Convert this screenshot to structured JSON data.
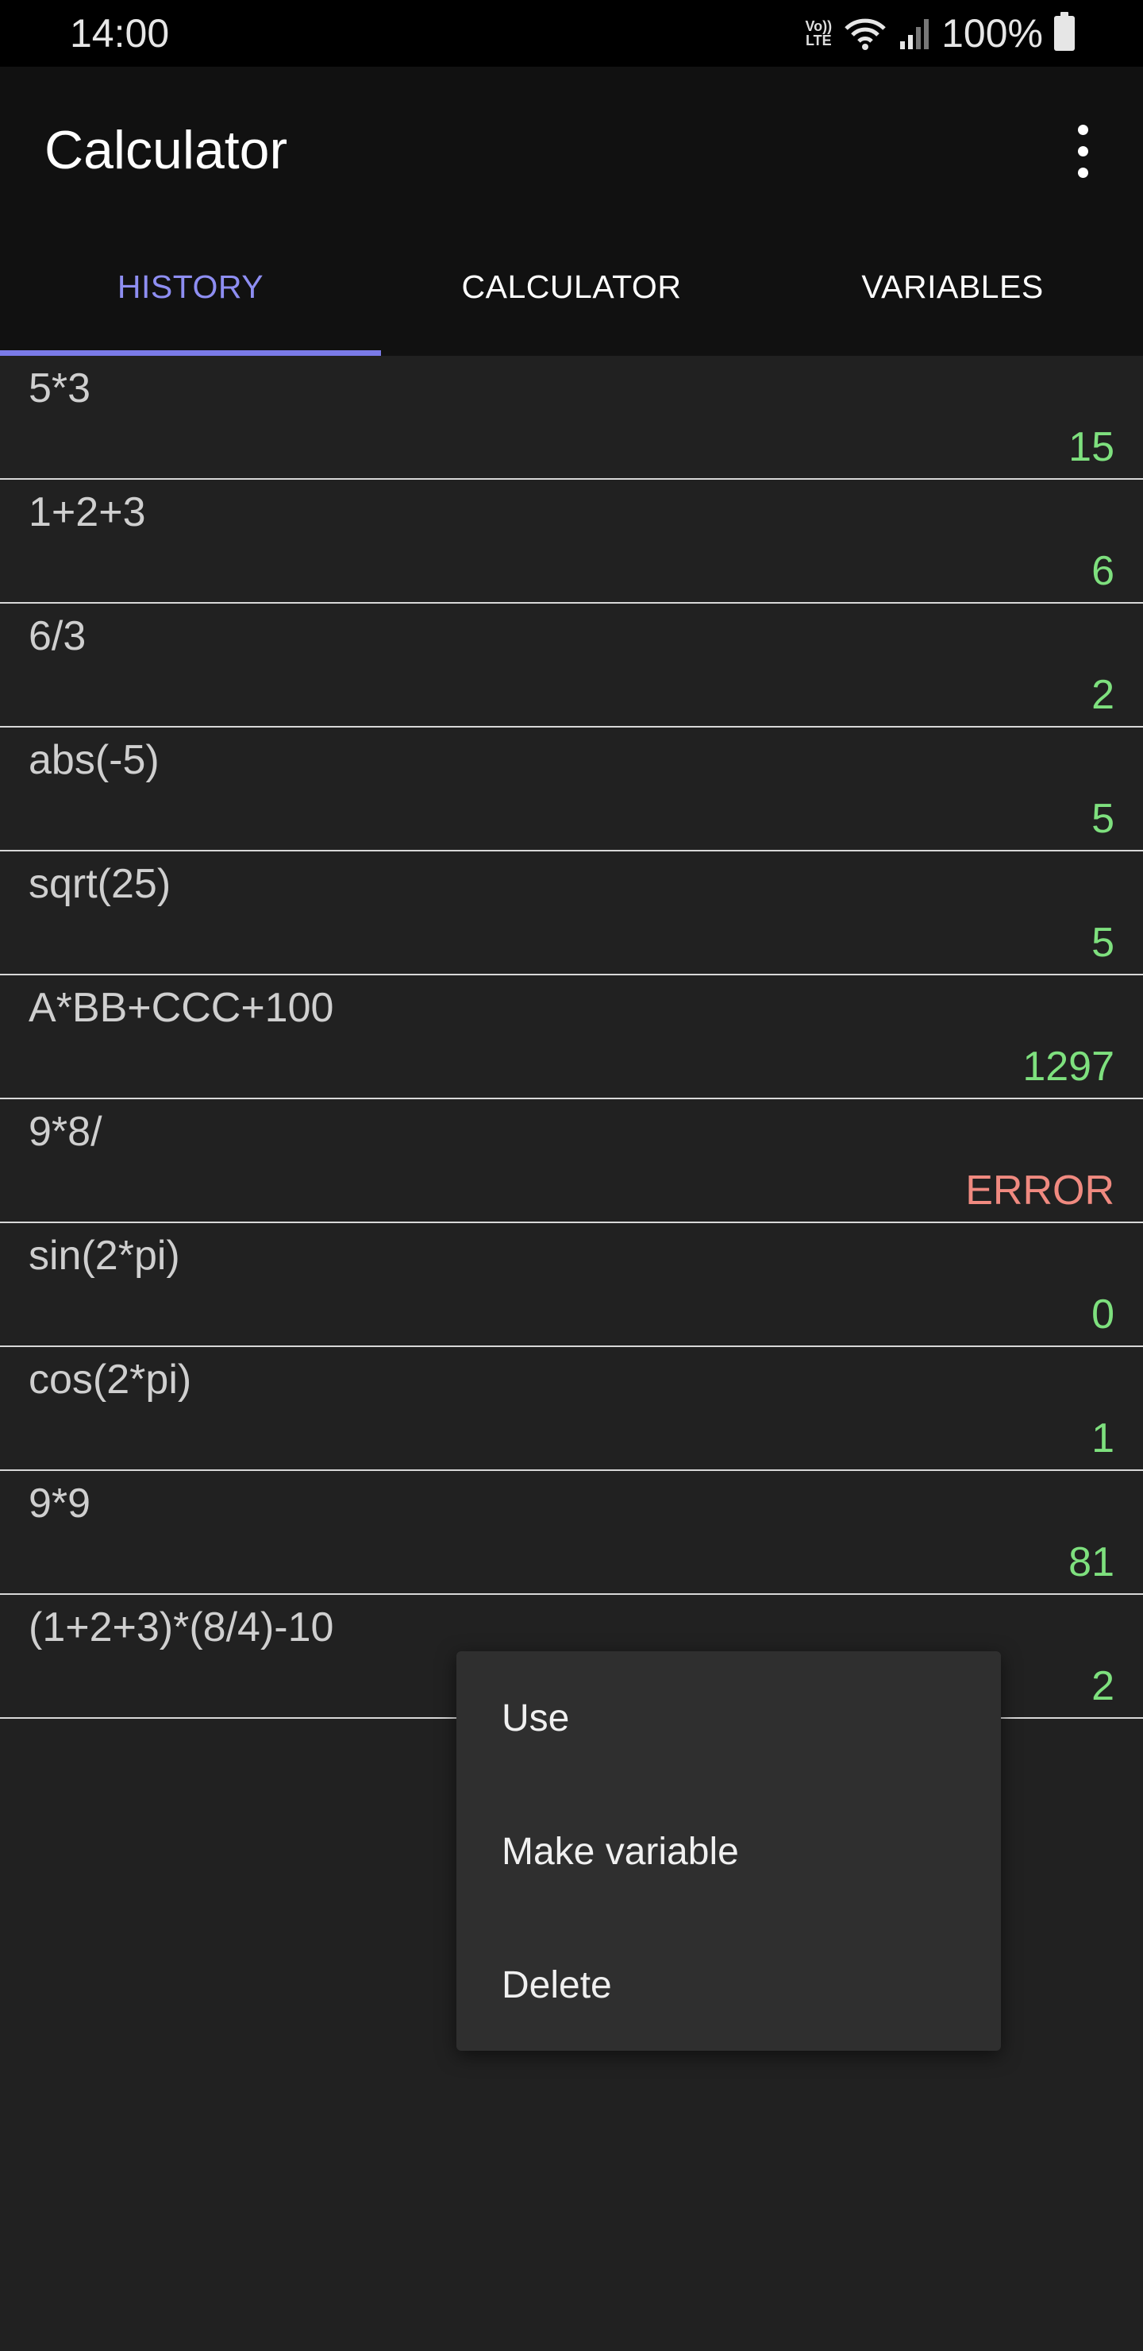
{
  "status_bar": {
    "time": "14:00",
    "volte_line1": "Vo))",
    "volte_line2": "LTE",
    "battery_text": "100%"
  },
  "app_bar": {
    "title": "Calculator"
  },
  "tabs": [
    {
      "label": "HISTORY",
      "active": true
    },
    {
      "label": "CALCULATOR",
      "active": false
    },
    {
      "label": "VARIABLES",
      "active": false
    }
  ],
  "history": [
    {
      "expression": "5*3",
      "result": "15"
    },
    {
      "expression": "1+2+3",
      "result": "6"
    },
    {
      "expression": "6/3",
      "result": "2"
    },
    {
      "expression": "abs(-5)",
      "result": "5"
    },
    {
      "expression": "sqrt(25)",
      "result": "5"
    },
    {
      "expression": "A*BB+CCC+100",
      "result": "1297"
    },
    {
      "expression": "9*8/",
      "result": "ERROR"
    },
    {
      "expression": "sin(2*pi)",
      "result": "0"
    },
    {
      "expression": "cos(2*pi)",
      "result": "1"
    },
    {
      "expression": "9*9",
      "result": "81"
    },
    {
      "expression": "(1+2+3)*(8/4)-10",
      "result": "2"
    }
  ],
  "context_menu": {
    "items": [
      "Use",
      "Make variable",
      "Delete"
    ]
  },
  "colors": {
    "accent": "#7a7ae8",
    "result": "#7ee07e",
    "error": "#f08a80",
    "background": "#212121"
  }
}
